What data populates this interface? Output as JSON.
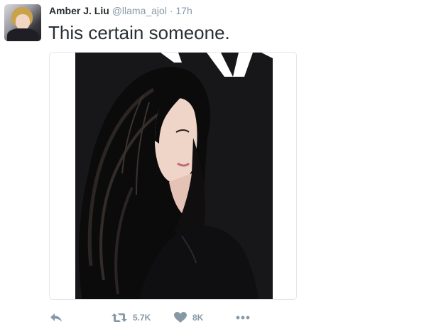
{
  "tweet": {
    "display_name": "Amber J. Liu",
    "handle": "@llama_ajol",
    "separator": "·",
    "time": "17h",
    "text": "This certain someone."
  },
  "actions": {
    "retweet_count": "5.7K",
    "like_count": "8K"
  },
  "icons": {
    "reply": "reply-icon",
    "retweet": "retweet-icon",
    "like": "heart-icon",
    "more": "more-dots-icon"
  },
  "colors": {
    "text": "#292f33",
    "muted": "#8899a6",
    "border": "#e1e8ed"
  }
}
